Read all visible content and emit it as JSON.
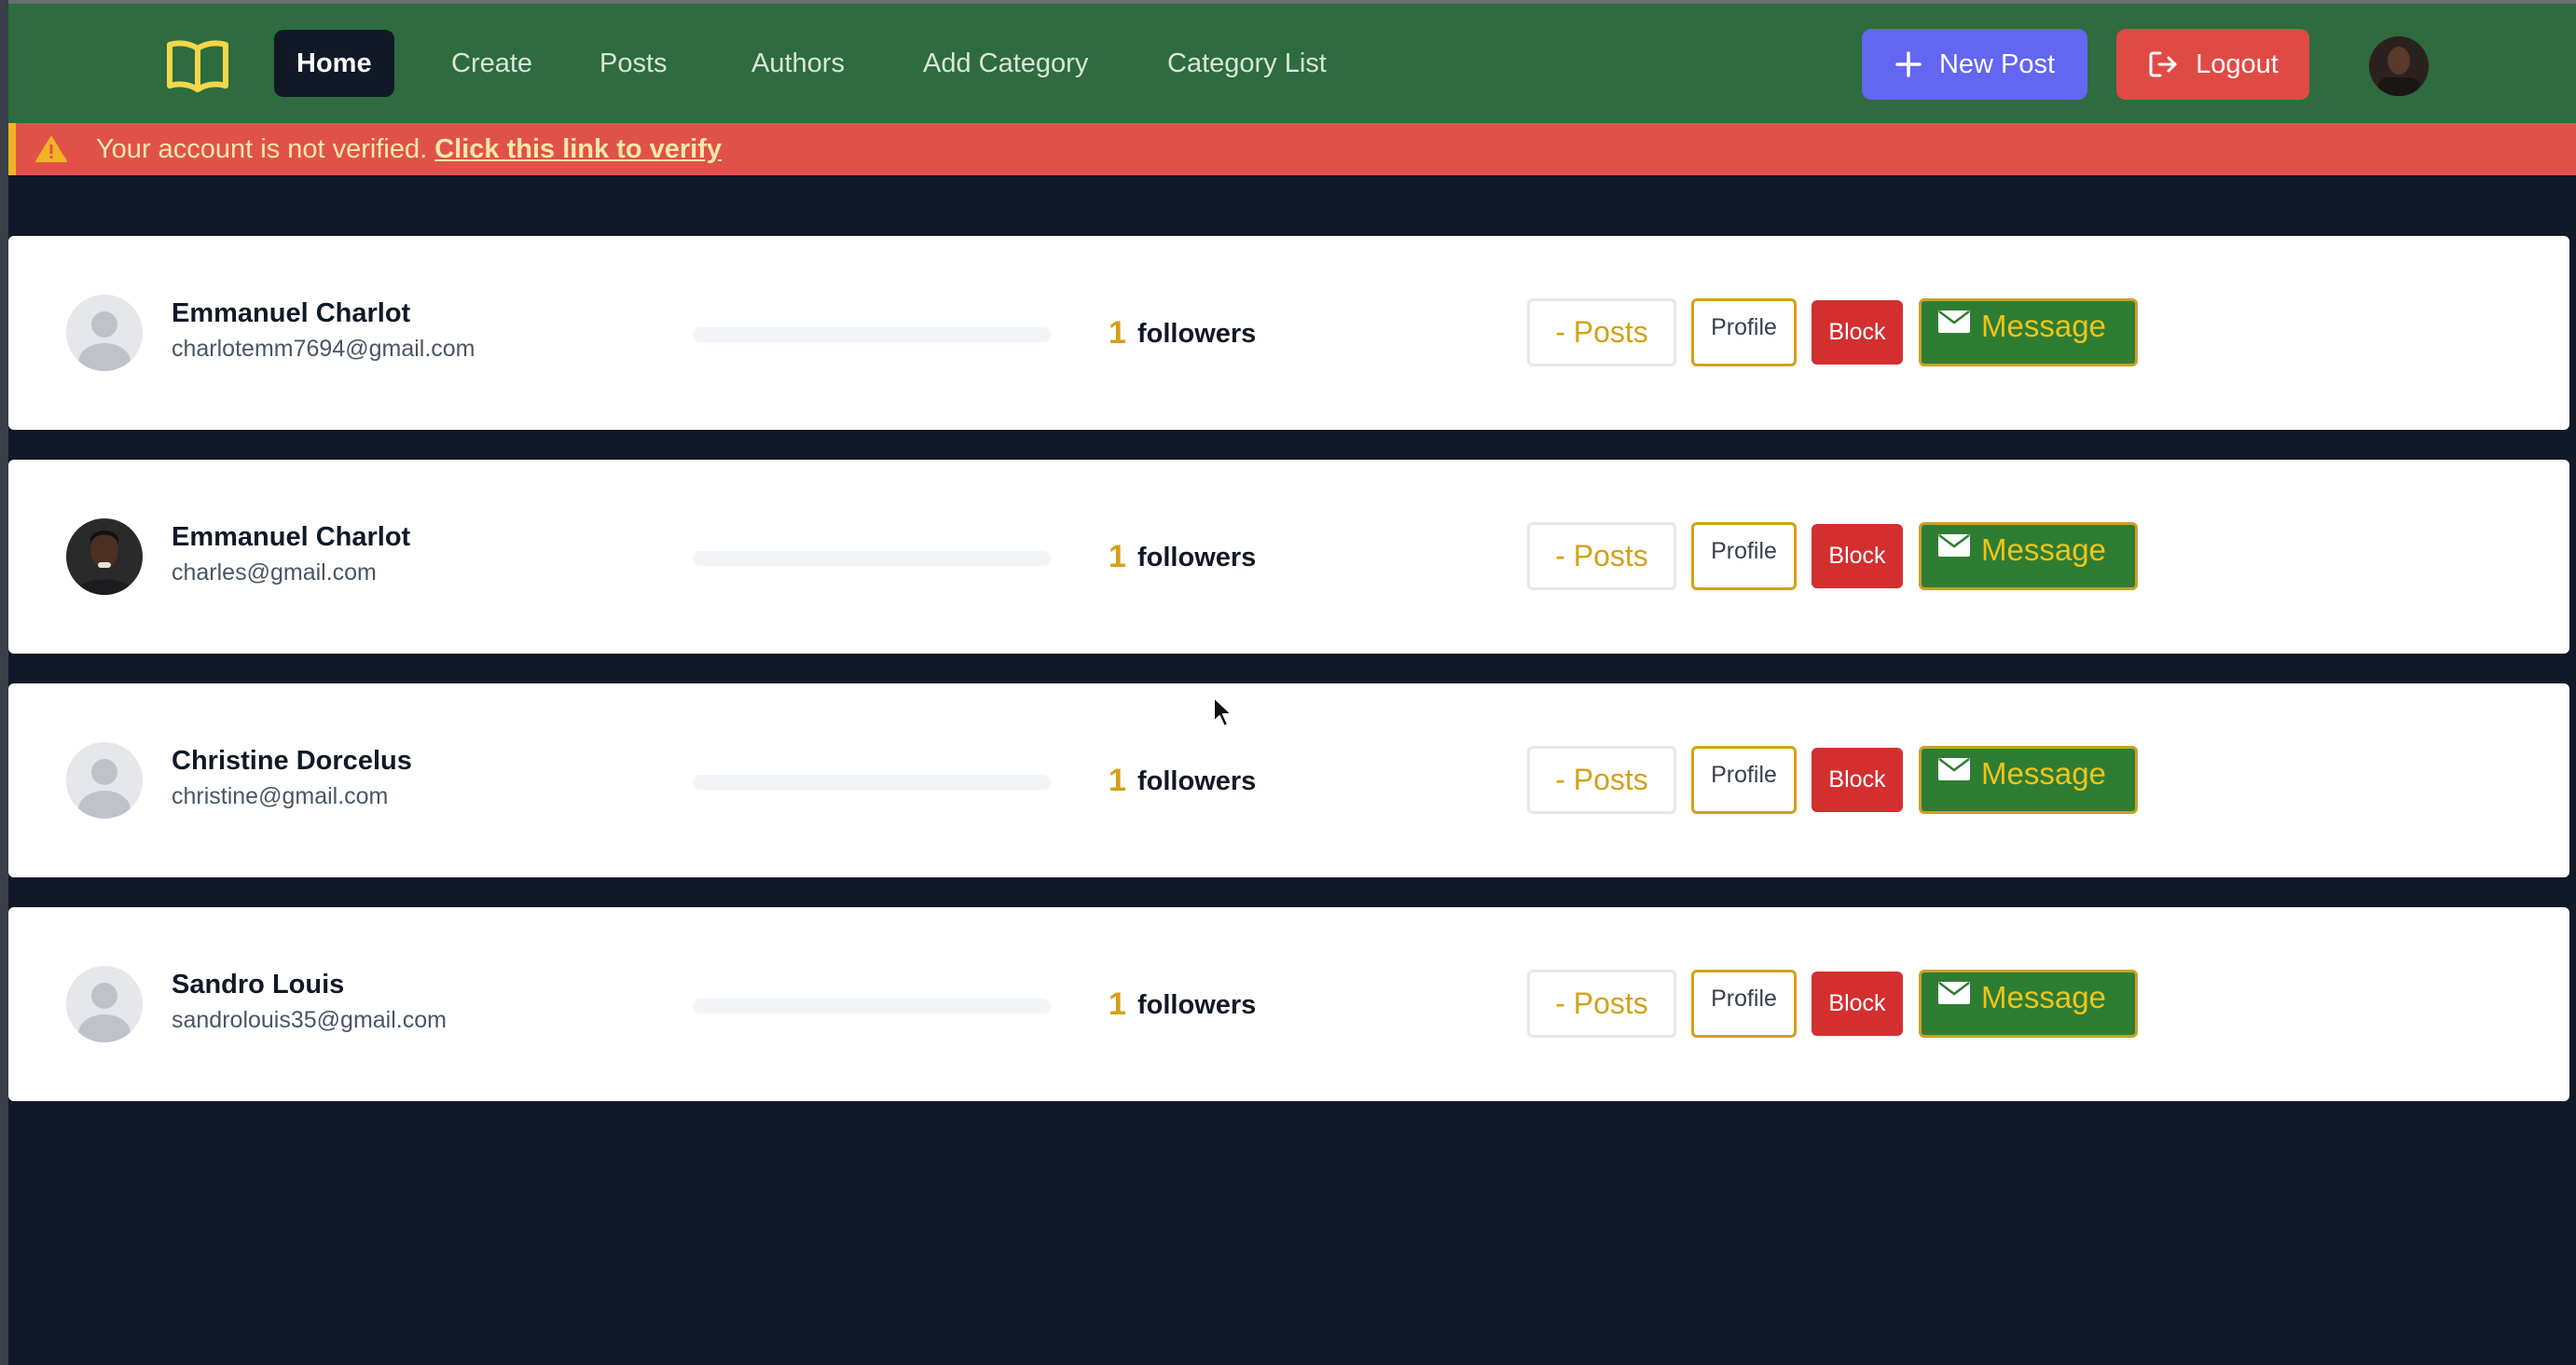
{
  "nav": {
    "items": [
      {
        "label": "Home",
        "active": true
      },
      {
        "label": "Create",
        "active": false
      },
      {
        "label": "Posts",
        "active": false
      },
      {
        "label": "Authors",
        "active": false
      },
      {
        "label": "Add Category",
        "active": false
      },
      {
        "label": "Category List",
        "active": false
      }
    ],
    "new_post_label": "New Post",
    "logout_label": "Logout",
    "logo_icon": "open-book-icon"
  },
  "alert": {
    "text": "Your account is not verified.",
    "link_text": "Click this link to verify",
    "icon": "warning-icon"
  },
  "authors": [
    {
      "name": "Emmanuel Charlot",
      "email": "charlotemm7694@gmail.com",
      "followers": "1",
      "followers_label": "followers",
      "avatar": "placeholder"
    },
    {
      "name": "Emmanuel Charlot",
      "email": "charles@gmail.com",
      "followers": "1",
      "followers_label": "followers",
      "avatar": "photo"
    },
    {
      "name": "Christine Dorcelus",
      "email": "christine@gmail.com",
      "followers": "1",
      "followers_label": "followers",
      "avatar": "placeholder"
    },
    {
      "name": "Sandro Louis",
      "email": "sandrolouis35@gmail.com",
      "followers": "1",
      "followers_label": "followers",
      "avatar": "placeholder"
    }
  ],
  "card_buttons": {
    "posts_label": "- Posts",
    "profile_label": "Profile",
    "block_label": "Block",
    "message_label": "Message"
  },
  "colors": {
    "navbar": "#2e6b3e",
    "page_bg": "#111827",
    "alert_bg": "#e05249",
    "new_post": "#6366f1",
    "logout": "#e04a45",
    "block": "#d32f2f",
    "message": "#2f7d32",
    "accent_gold": "#d4a017"
  }
}
